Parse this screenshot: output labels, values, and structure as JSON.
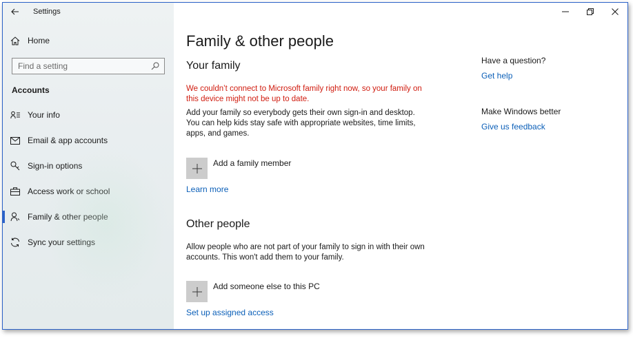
{
  "window": {
    "app_title": "Settings",
    "controls": {
      "minimize": "—",
      "maximize": "❐",
      "close": "✕"
    }
  },
  "sidebar": {
    "home_label": "Home",
    "search_placeholder": "Find a setting",
    "section_title": "Accounts",
    "items": [
      {
        "label": "Your info",
        "icon": "person-list-icon"
      },
      {
        "label": "Email & app accounts",
        "icon": "mail-icon"
      },
      {
        "label": "Sign-in options",
        "icon": "key-icon"
      },
      {
        "label": "Access work or school",
        "icon": "briefcase-icon"
      },
      {
        "label": "Family & other people",
        "icon": "people-icon",
        "active": true
      },
      {
        "label": "Sync your settings",
        "icon": "sync-icon"
      }
    ]
  },
  "main": {
    "title": "Family & other people",
    "family": {
      "heading": "Your family",
      "warning": "We couldn’t connect to Microsoft family right now, so your family on this device might not be up to date.",
      "description": "Add your family so everybody gets their own sign-in and desktop. You can help kids stay safe with appropriate websites, time limits, apps, and games.",
      "add_label": "Add a family member",
      "learn_more": "Learn more"
    },
    "other": {
      "heading": "Other people",
      "description": "Allow people who are not part of your family to sign in with their own accounts. This won't add them to your family.",
      "add_label": "Add someone else to this PC",
      "assigned_access": "Set up assigned access"
    },
    "aside": {
      "question_heading": "Have a question?",
      "get_help": "Get help",
      "improve_heading": "Make Windows better",
      "feedback": "Give us feedback"
    }
  },
  "colors": {
    "accent": "#2b62c8",
    "link": "#0b5fb8",
    "warning": "#d01b0e"
  }
}
